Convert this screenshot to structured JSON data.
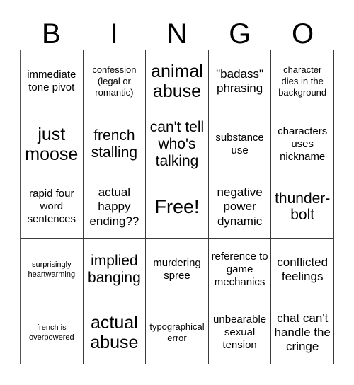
{
  "card": {
    "header_letters": [
      "B",
      "I",
      "N",
      "G",
      "O"
    ],
    "background_color": "#ffffff",
    "text_color": "#000000",
    "grid_line_color": "#3a3a3a",
    "rows": 5,
    "columns": 5
  },
  "cells": [
    {
      "text": "immediate tone pivot",
      "size": "fs-md",
      "row": 1,
      "col": 1
    },
    {
      "text": "confession (legal or romantic)",
      "size": "fs-sm",
      "row": 1,
      "col": 2
    },
    {
      "text": "animal abuse",
      "size": "fs-xxl",
      "row": 1,
      "col": 3
    },
    {
      "text": "\"badass\" phrasing",
      "size": "fs-lg",
      "row": 1,
      "col": 4
    },
    {
      "text": "character dies in the background",
      "size": "fs-sm",
      "row": 1,
      "col": 5
    },
    {
      "text": "just moose",
      "size": "fs-xxl",
      "row": 2,
      "col": 1
    },
    {
      "text": "french stalling",
      "size": "fs-xl",
      "row": 2,
      "col": 2
    },
    {
      "text": "can't tell who's talking",
      "size": "fs-xl",
      "row": 2,
      "col": 3
    },
    {
      "text": "substance use",
      "size": "fs-md",
      "row": 2,
      "col": 4
    },
    {
      "text": "characters uses nickname",
      "size": "fs-md",
      "row": 2,
      "col": 5
    },
    {
      "text": "rapid four word sentences",
      "size": "fs-md",
      "row": 3,
      "col": 1
    },
    {
      "text": "actual happy ending??",
      "size": "fs-lg",
      "row": 3,
      "col": 2
    },
    {
      "text": "Free!",
      "size": "fs-free",
      "row": 3,
      "col": 3
    },
    {
      "text": "negative power dynamic",
      "size": "fs-lg",
      "row": 3,
      "col": 4
    },
    {
      "text": "thunder-bolt",
      "size": "fs-xl",
      "row": 3,
      "col": 5
    },
    {
      "text": "surprisingly heartwarming",
      "size": "fs-xs",
      "row": 4,
      "col": 1
    },
    {
      "text": "implied banging",
      "size": "fs-xl",
      "row": 4,
      "col": 2
    },
    {
      "text": "murdering spree",
      "size": "fs-md",
      "row": 4,
      "col": 3
    },
    {
      "text": "reference to game mechanics",
      "size": "fs-md",
      "row": 4,
      "col": 4
    },
    {
      "text": "conflicted feelings",
      "size": "fs-lg",
      "row": 4,
      "col": 5
    },
    {
      "text": "french is overpowered",
      "size": "fs-xs",
      "row": 5,
      "col": 1
    },
    {
      "text": "actual abuse",
      "size": "fs-xxl",
      "row": 5,
      "col": 2
    },
    {
      "text": "typographical error",
      "size": "fs-sm",
      "row": 5,
      "col": 3
    },
    {
      "text": "unbearable sexual tension",
      "size": "fs-md",
      "row": 5,
      "col": 4
    },
    {
      "text": "chat can't handle the cringe",
      "size": "fs-lg",
      "row": 5,
      "col": 5
    }
  ]
}
